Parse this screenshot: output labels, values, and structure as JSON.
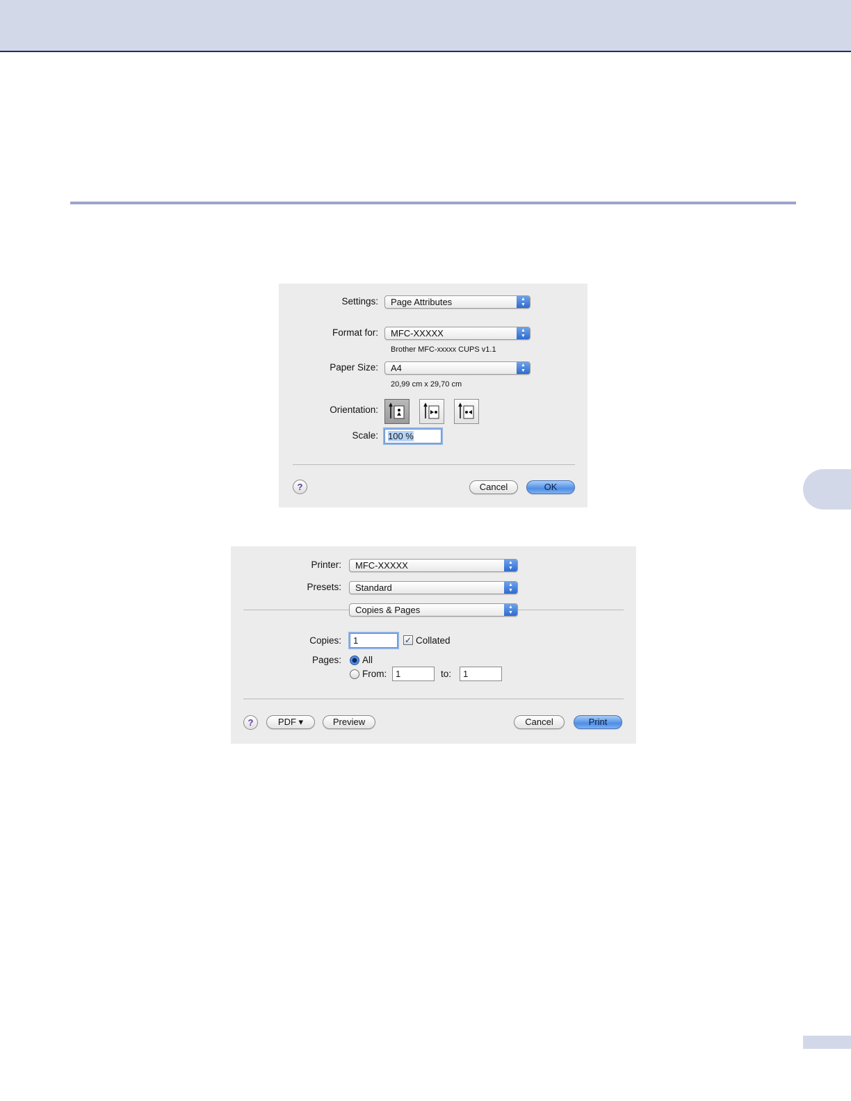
{
  "page_setup": {
    "settings": {
      "label": "Settings:",
      "value": "Page Attributes"
    },
    "format_for": {
      "label": "Format for:",
      "value": "MFC-XXXXX",
      "info": "Brother MFC-xxxxx CUPS v1.1"
    },
    "paper_size": {
      "label": "Paper Size:",
      "value": "A4",
      "info": "20,99 cm x 29,70 cm"
    },
    "orientation": {
      "label": "Orientation:",
      "selected": "portrait",
      "options": [
        "portrait",
        "landscape-left",
        "landscape-right"
      ]
    },
    "scale": {
      "label": "Scale:",
      "value": "100 %"
    },
    "help_label": "?",
    "cancel_label": "Cancel",
    "ok_label": "OK"
  },
  "print_dialog": {
    "printer": {
      "label": "Printer:",
      "value": "MFC-XXXXX"
    },
    "presets": {
      "label": "Presets:",
      "value": "Standard"
    },
    "panel": {
      "value": "Copies & Pages"
    },
    "copies": {
      "label": "Copies:",
      "value": "1",
      "collated_label": "Collated",
      "collated": true
    },
    "pages": {
      "label": "Pages:",
      "all_label": "All",
      "from_label": "From:",
      "from_value": "1",
      "to_label": "to:",
      "to_value": "1",
      "selected": "all"
    },
    "help_label": "?",
    "pdf_label": "PDF ▾",
    "preview_label": "Preview",
    "cancel_label": "Cancel",
    "print_label": "Print"
  },
  "colors": {
    "header_band": "#d3d8e9",
    "header_rule": "#1e2a6e",
    "section_rule": "#9da4cc",
    "dialog_bg": "#ececec",
    "accent_blue": "#4f8ee5"
  }
}
